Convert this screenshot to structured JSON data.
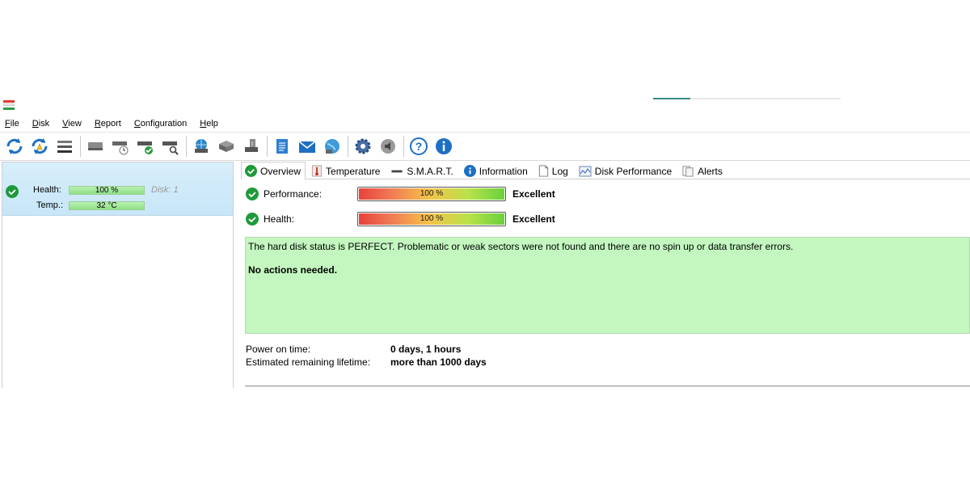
{
  "menu": [
    {
      "key": "F",
      "rest": "ile"
    },
    {
      "key": "D",
      "rest": "isk"
    },
    {
      "key": "V",
      "rest": "iew"
    },
    {
      "key": "R",
      "rest": "eport"
    },
    {
      "key": "C",
      "rest": "onfiguration"
    },
    {
      "key": "H",
      "rest": "elp"
    }
  ],
  "toolbar": {
    "icons": [
      "refresh-icon",
      "refresh-warning-icon",
      "disk-list-icon",
      "disk-icon",
      "disk-schedule-icon",
      "disk-check-icon",
      "disk-search-icon",
      "network-disk-icon",
      "disk-transfer-icon",
      "disk-install-icon",
      "notes-icon",
      "email-icon",
      "globe-icon",
      "settings-icon",
      "sound-icon",
      "help-icon",
      "info-icon"
    ]
  },
  "disk_card": {
    "health_label": "Health:",
    "health_value": "100 %",
    "health_fraction": 1.0,
    "temp_label": "Temp.:",
    "temp_value": "32 °C",
    "disk_label": "Disk: 1"
  },
  "tabs": [
    {
      "label": "Overview",
      "icon": "check-circle-icon",
      "active": true
    },
    {
      "label": "Temperature",
      "icon": "thermometer-icon",
      "active": false
    },
    {
      "label": "S.M.A.R.T.",
      "icon": "smart-bar-icon",
      "active": false
    },
    {
      "label": "Information",
      "icon": "info-circle-icon",
      "active": false
    },
    {
      "label": "Log",
      "icon": "document-icon",
      "active": false
    },
    {
      "label": "Disk Performance",
      "icon": "performance-chart-icon",
      "active": false
    },
    {
      "label": "Alerts",
      "icon": "alerts-icon",
      "active": false
    }
  ],
  "overview": {
    "performance": {
      "label": "Performance:",
      "value": "100 %",
      "fraction": 1.0,
      "rating": "Excellent"
    },
    "health": {
      "label": "Health:",
      "value": "100 %",
      "fraction": 1.0,
      "rating": "Excellent"
    },
    "status_message": "The hard disk status is PERFECT. Problematic or weak sectors were not found and there are no spin up or data transfer errors.",
    "action_message": "No actions needed.",
    "power_on_label": "Power on time:",
    "power_on_value": "0 days, 1 hours",
    "lifetime_label": "Estimated remaining lifetime:",
    "lifetime_value": "more than 1000 days"
  },
  "colors": {
    "status_ok": "#c3f7bf",
    "selection": "#c7e6f8",
    "check_green": "#1f9a3a",
    "accent_blue": "#1a73c8"
  }
}
